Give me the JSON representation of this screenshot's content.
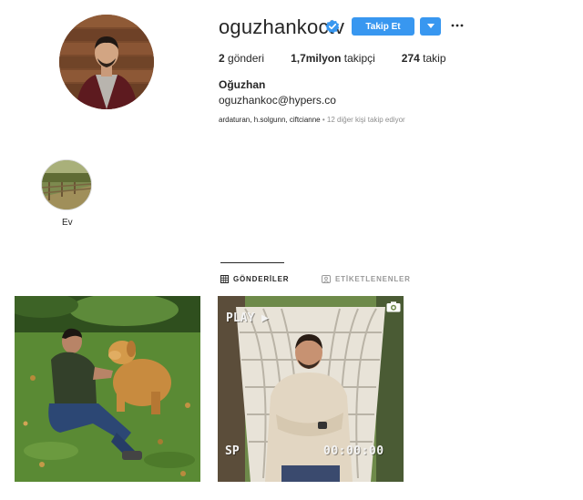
{
  "profile": {
    "username": "oguzhankoctv",
    "follow_label": "Takip Et",
    "full_name": "Oğuzhan",
    "bio_email": "oguzhankoc@hypers.co",
    "stats": {
      "posts_count": "2",
      "posts_label": "gönderi",
      "followers_count": "1,7milyon",
      "followers_label": "takipçi",
      "following_count": "274",
      "following_label": "takip"
    },
    "followed_by": {
      "names": "ardaturan, h.solgunn, ciftcianne",
      "more": "• 12 diğer kişi takip ediyor"
    }
  },
  "highlights": [
    {
      "label": "Ev"
    }
  ],
  "tabs": {
    "posts": "GÖNDERİLER",
    "tagged": "ETİKETLENENLER"
  },
  "posts": {
    "vhs_play": "PLAY ▶",
    "vhs_sp": "SP",
    "vhs_time": "00:00:00"
  },
  "icons": [
    "verified-badge-icon",
    "chevron-down-icon",
    "more-options-icon",
    "grid-icon",
    "tagged-icon",
    "camera-icon"
  ],
  "colors": {
    "accent": "#3897f0",
    "text": "#262626",
    "muted": "#8e8e8e"
  }
}
